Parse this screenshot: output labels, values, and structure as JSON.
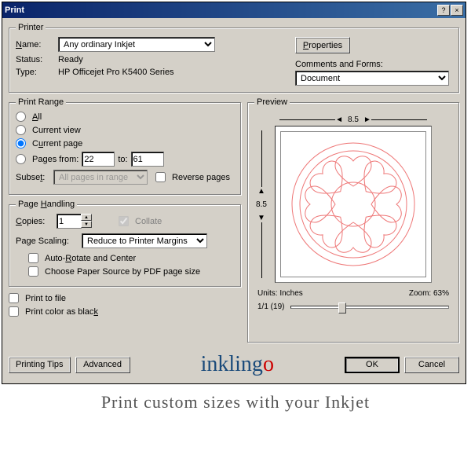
{
  "window": {
    "title": "Print",
    "help": "?",
    "close": "×"
  },
  "printer": {
    "legend": "Printer",
    "name_label": "Name:",
    "name_value": "Any ordinary Inkjet",
    "properties_btn": "Properties",
    "status_label": "Status:",
    "status_value": "Ready",
    "type_label": "Type:",
    "type_value": "HP Officejet Pro K5400 Series",
    "comments_label": "Comments and Forms:",
    "comments_value": "Document"
  },
  "range": {
    "legend": "Print Range",
    "all": "All",
    "current_view": "Current view",
    "current_page": "Current page",
    "pages_from": "Pages from:",
    "from_val": "22",
    "to": "to:",
    "to_val": "61",
    "subset": "Subset:",
    "subset_val": "All pages in range",
    "reverse": "Reverse pages"
  },
  "handling": {
    "legend": "Page Handling",
    "copies": "Copies:",
    "copies_val": "1",
    "collate": "Collate",
    "scaling": "Page Scaling:",
    "scaling_val": "Reduce to Printer Margins",
    "auto_rotate": "Auto-Rotate and Center",
    "paper_source": "Choose Paper Source by PDF page size"
  },
  "misc": {
    "print_to_file": "Print to file",
    "print_black": "Print color as black"
  },
  "preview": {
    "legend": "Preview",
    "width": "8.5",
    "height": "8.5",
    "units_label": "Units:",
    "units_val": "Inches",
    "zoom_label": "Zoom:",
    "zoom_val": "63%",
    "page_info": "1/1 (19)"
  },
  "buttons": {
    "tips": "Printing Tips",
    "advanced": "Advanced",
    "ok": "OK",
    "cancel": "Cancel"
  },
  "caption": "Print custom sizes with your Inkjet",
  "logo": "inklingo"
}
